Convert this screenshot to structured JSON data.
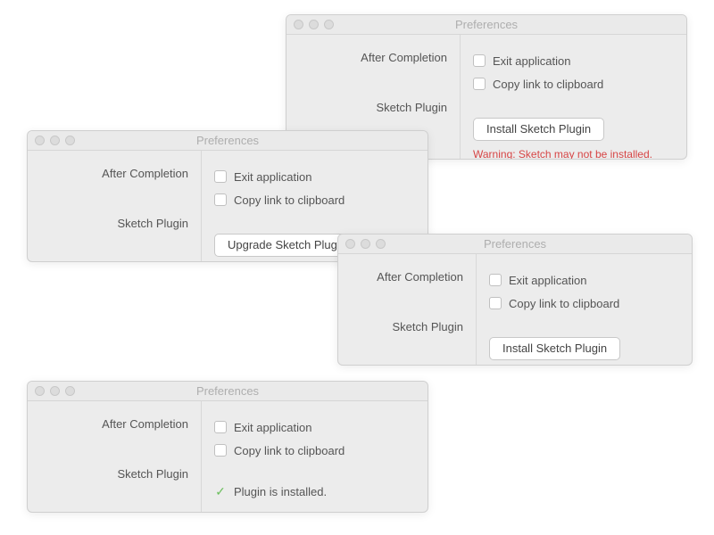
{
  "windows": {
    "w1": {
      "title": "Preferences",
      "labels": {
        "afterCompletion": "After Completion",
        "sketchPlugin": "Sketch Plugin"
      },
      "checkboxes": {
        "exit": "Exit application",
        "copy": "Copy link to clipboard"
      },
      "button": "Install Sketch Plugin",
      "warning": "Warning: Sketch may not be installed."
    },
    "w2": {
      "title": "Preferences",
      "labels": {
        "afterCompletion": "After Completion",
        "sketchPlugin": "Sketch Plugin"
      },
      "checkboxes": {
        "exit": "Exit application",
        "copy": "Copy link to clipboard"
      },
      "button": "Upgrade Sketch Plugin"
    },
    "w3": {
      "title": "Preferences",
      "labels": {
        "afterCompletion": "After Completion",
        "sketchPlugin": "Sketch Plugin"
      },
      "checkboxes": {
        "exit": "Exit application",
        "copy": "Copy link to clipboard"
      },
      "button": "Install Sketch Plugin"
    },
    "w4": {
      "title": "Preferences",
      "labels": {
        "afterCompletion": "After Completion",
        "sketchPlugin": "Sketch Plugin"
      },
      "checkboxes": {
        "exit": "Exit application",
        "copy": "Copy link to clipboard"
      },
      "installed": "Plugin is installed."
    }
  }
}
